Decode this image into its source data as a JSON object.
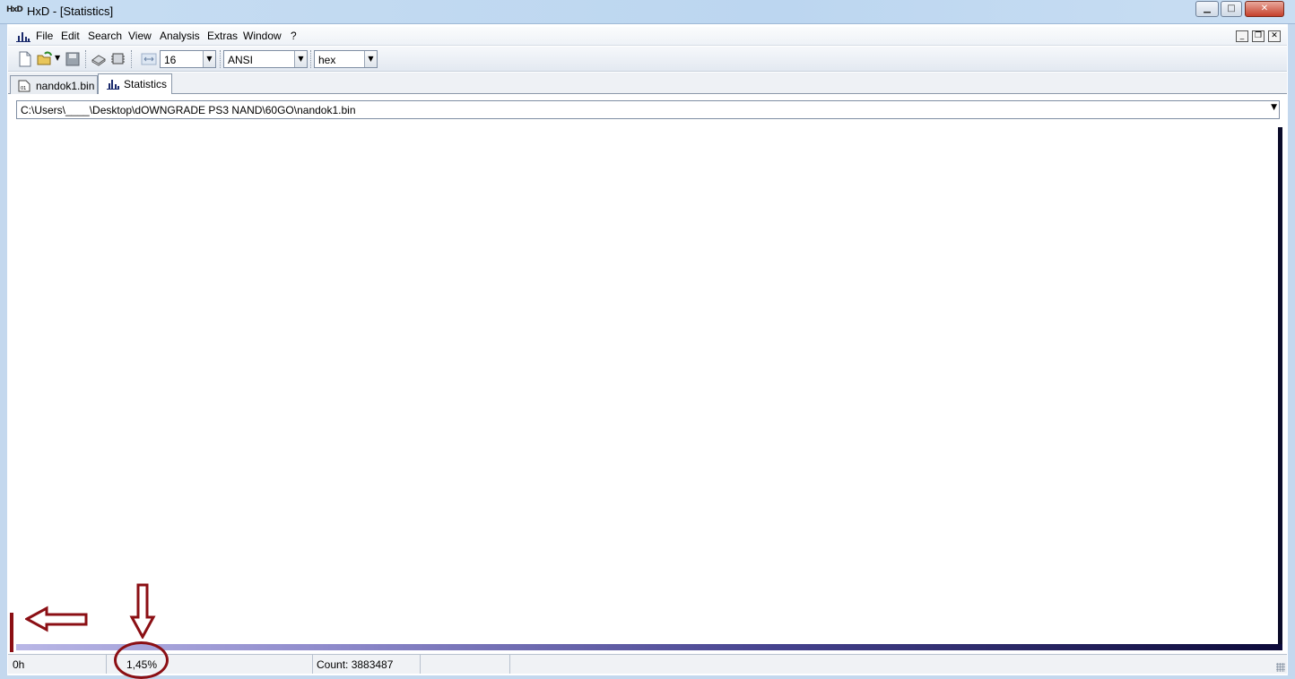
{
  "window": {
    "app_icon_text": "HxD",
    "title": "HxD - [Statistics]",
    "minimize_glyph": "▁",
    "maximize_glyph": "□",
    "close_glyph": "✕"
  },
  "menu": {
    "items": [
      "File",
      "Edit",
      "Search",
      "View",
      "Analysis",
      "Extras",
      "Window",
      "?"
    ],
    "mdi_min": "_",
    "mdi_restore": "❐",
    "mdi_close": "✕"
  },
  "toolbar": {
    "bytes_per_row": "16",
    "charset": "ANSI",
    "offset_base": "hex",
    "icons": [
      "new-file-icon",
      "open-file-icon",
      "save-icon",
      "open-disk-icon",
      "open-ram-icon",
      "bytes-per-row-icon"
    ]
  },
  "tabs": [
    {
      "label": "nandok1.bin",
      "icon": "hex-file-icon",
      "active": false
    },
    {
      "label": "Statistics",
      "icon": "statistics-icon",
      "active": true
    }
  ],
  "path": {
    "value": "C:\\Users\\____\\Desktop\\dOWNGRADE PS3 NAND\\60GO\\nandok1.bin"
  },
  "statusbar": {
    "offset": "0h",
    "percent": "1,45%",
    "count": "Count: 3883487"
  },
  "colors": {
    "annotation": "#8b0f14",
    "titlebar": "#c7ddf2"
  }
}
